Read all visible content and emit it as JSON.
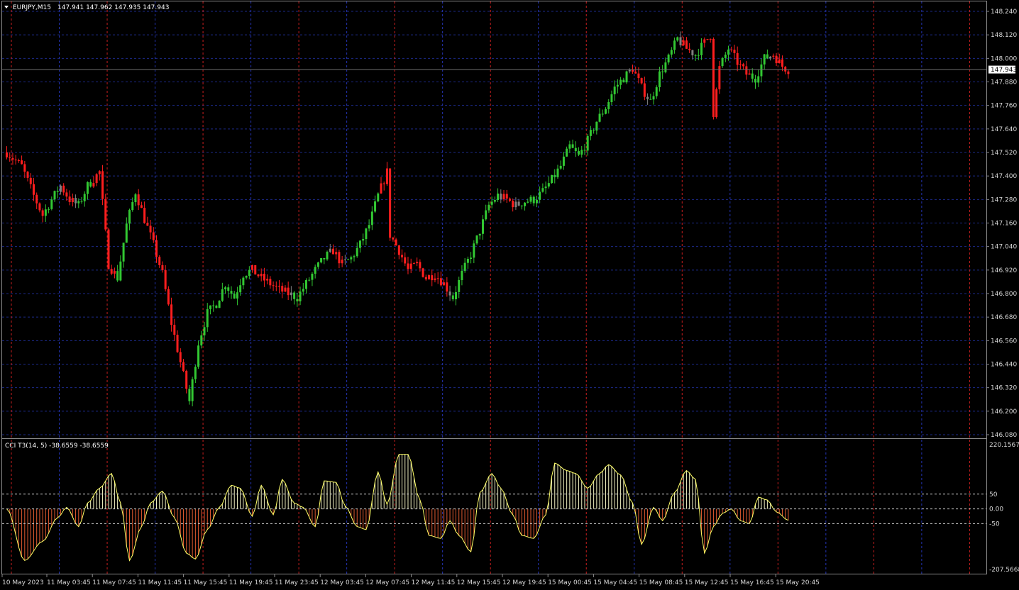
{
  "header": {
    "symbol": "EURJPY,M15",
    "ohlc": "147.941 147.962 147.935 147.943",
    "dropdown_icon": "triangle-down-icon"
  },
  "indicator_header": "CCI T3(14, 5) -38.6559 -38.6559",
  "current_price": "147.943",
  "colors": {
    "background": "#000000",
    "up": "#32c832",
    "down": "#ff1e1e",
    "neutral": "#808080",
    "grid_h": "#1c2a88",
    "grid_v_blue": "#2434b4",
    "grid_v_red": "#c81e1e",
    "cci_line": "#ffff66",
    "cci_pos_fill": "#f0f0c0",
    "cci_neg_fill": "#e05a30",
    "axis_text": "#d8d8d8",
    "price_tag_bg": "#ffffff"
  },
  "chart_data": [
    {
      "type": "candlestick",
      "symbol": "EURJPY",
      "timeframe": "M15",
      "ylim": [
        146.08,
        148.24
      ],
      "y_ticks": [
        "148.240",
        "148.120",
        "148.000",
        "147.880",
        "147.760",
        "147.640",
        "147.520",
        "147.400",
        "147.280",
        "147.160",
        "147.040",
        "146.920",
        "146.800",
        "146.680",
        "146.560",
        "146.440",
        "146.320",
        "146.200",
        "146.080"
      ],
      "x_ticks": [
        "10 May 2023",
        "11 May 03:45",
        "11 May 07:45",
        "11 May 11:45",
        "11 May 15:45",
        "11 May 19:45",
        "11 May 23:45",
        "12 May 03:45",
        "12 May 07:45",
        "12 May 11:45",
        "12 May 15:45",
        "12 May 19:45",
        "15 May 00:45",
        "15 May 04:45",
        "15 May 08:45",
        "15 May 12:45",
        "15 May 16:45",
        "15 May 20:45"
      ],
      "close_path": [
        [
          0,
          147.52
        ],
        [
          5,
          147.45
        ],
        [
          9,
          147.3
        ],
        [
          12,
          147.2
        ],
        [
          15,
          147.28
        ],
        [
          18,
          147.35
        ],
        [
          21,
          147.28
        ],
        [
          24,
          147.25
        ],
        [
          27,
          147.35
        ],
        [
          31,
          147.42
        ],
        [
          34,
          146.95
        ],
        [
          37,
          146.88
        ],
        [
          40,
          147.15
        ],
        [
          43,
          147.32
        ],
        [
          46,
          147.18
        ],
        [
          49,
          147.05
        ],
        [
          52,
          146.9
        ],
        [
          55,
          146.65
        ],
        [
          58,
          146.45
        ],
        [
          61,
          146.25
        ],
        [
          64,
          146.55
        ],
        [
          67,
          146.7
        ],
        [
          70,
          146.75
        ],
        [
          73,
          146.85
        ],
        [
          76,
          146.78
        ],
        [
          79,
          146.9
        ],
        [
          82,
          146.92
        ],
        [
          85,
          146.88
        ],
        [
          88,
          146.85
        ],
        [
          91,
          146.82
        ],
        [
          94,
          146.8
        ],
        [
          97,
          146.78
        ],
        [
          100,
          146.85
        ],
        [
          103,
          146.92
        ],
        [
          106,
          146.98
        ],
        [
          109,
          147.02
        ],
        [
          112,
          146.95
        ],
        [
          115,
          146.98
        ],
        [
          118,
          147.05
        ],
        [
          121,
          147.15
        ],
        [
          124,
          147.3
        ],
        [
          127,
          147.42
        ],
        [
          128,
          147.1
        ],
        [
          131,
          147.02
        ],
        [
          134,
          146.92
        ],
        [
          137,
          146.95
        ],
        [
          140,
          146.88
        ],
        [
          143,
          146.9
        ],
        [
          146,
          146.85
        ],
        [
          149,
          146.78
        ],
        [
          152,
          146.9
        ],
        [
          155,
          147.0
        ],
        [
          158,
          147.12
        ],
        [
          161,
          147.25
        ],
        [
          164,
          147.3
        ],
        [
          167,
          147.28
        ],
        [
          170,
          147.25
        ],
        [
          173,
          147.27
        ],
        [
          176,
          147.28
        ],
        [
          179,
          147.32
        ],
        [
          182,
          147.38
        ],
        [
          185,
          147.45
        ],
        [
          188,
          147.55
        ],
        [
          191,
          147.5
        ],
        [
          194,
          147.58
        ],
        [
          197,
          147.68
        ],
        [
          200,
          147.75
        ],
        [
          203,
          147.85
        ],
        [
          206,
          147.9
        ],
        [
          209,
          147.95
        ],
        [
          212,
          147.85
        ],
        [
          215,
          147.78
        ],
        [
          218,
          147.92
        ],
        [
          221,
          148.0
        ],
        [
          224,
          148.1
        ],
        [
          227,
          148.05
        ],
        [
          230,
          148.02
        ],
        [
          233,
          148.08
        ],
        [
          235,
          148.12
        ],
        [
          236,
          147.72
        ],
        [
          238,
          147.95
        ],
        [
          241,
          148.05
        ],
        [
          244,
          147.98
        ],
        [
          247,
          147.92
        ],
        [
          250,
          147.9
        ],
        [
          253,
          148.0
        ],
        [
          256,
          148.02
        ],
        [
          259,
          147.96
        ],
        [
          261,
          147.943
        ]
      ],
      "candle_count": 262
    },
    {
      "type": "area",
      "name": "CCI T3(14, 5)",
      "value": -38.6559,
      "ylim": [
        -207.5668,
        220.1567
      ],
      "y_ticks": [
        "220.1567",
        "50",
        "0.00",
        "-50",
        "-207.5668"
      ],
      "levels": [
        50,
        0,
        -50
      ],
      "x": [
        0,
        6,
        12,
        17,
        20,
        24,
        27,
        31,
        35,
        38,
        41,
        45,
        48,
        52,
        56,
        60,
        63,
        67,
        71,
        75,
        78,
        82,
        85,
        89,
        92,
        96,
        99,
        103,
        106,
        110,
        113,
        117,
        120,
        124,
        127,
        131,
        134,
        138,
        141,
        145,
        148,
        151,
        155,
        158,
        162,
        165,
        169,
        172,
        176,
        180,
        183,
        187,
        190,
        194,
        198,
        201,
        205,
        209,
        212,
        216,
        219,
        223,
        227,
        230,
        233,
        236,
        239,
        242,
        245,
        248,
        251,
        254,
        257,
        261
      ],
      "values": [
        0,
        -175,
        -110,
        -30,
        5,
        -60,
        20,
        70,
        120,
        20,
        -175,
        -60,
        20,
        60,
        -30,
        -150,
        -170,
        -70,
        5,
        80,
        70,
        -25,
        80,
        -20,
        100,
        20,
        5,
        -60,
        95,
        90,
        10,
        -60,
        -70,
        125,
        15,
        185,
        185,
        30,
        -90,
        -100,
        -40,
        -90,
        -145,
        55,
        120,
        70,
        -20,
        -90,
        -100,
        -20,
        155,
        130,
        120,
        70,
        120,
        150,
        115,
        20,
        -120,
        5,
        -40,
        55,
        130,
        100,
        -150,
        -60,
        -15,
        0,
        -40,
        -50,
        40,
        30,
        -10,
        -38.66
      ]
    }
  ]
}
